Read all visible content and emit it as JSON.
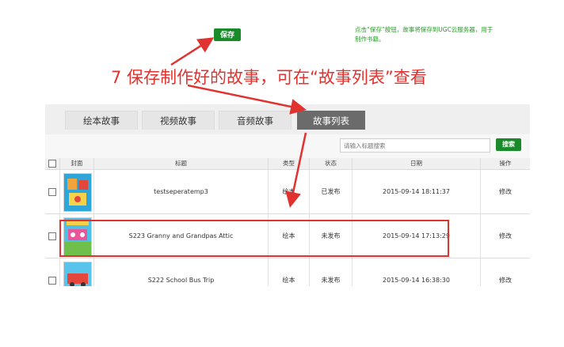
{
  "save_button": "保存",
  "tip": "点击“保存”按钮，故事将保存到UGC云服务器，用于制作书籍。",
  "step_annotation": "7 保存制作好的故事，可在“故事列表”查看",
  "tabs": [
    {
      "label": "绘本故事",
      "active": false
    },
    {
      "label": "视频故事",
      "active": false
    },
    {
      "label": "音频故事",
      "active": false
    },
    {
      "label": "故事列表",
      "active": true
    }
  ],
  "search": {
    "placeholder": "请输入标题搜索",
    "button": "搜索"
  },
  "table": {
    "headers": [
      "封面",
      "标题",
      "类型",
      "状态",
      "日期",
      "操作"
    ],
    "rows": [
      {
        "title": "testseperatemp3",
        "type": "绘本",
        "status": "已发布",
        "date": "2015-09-14 18:11:37",
        "action": "修改"
      },
      {
        "title": "S223 Granny and Grandpas Attic",
        "type": "绘本",
        "status": "未发布",
        "date": "2015-09-14 17:13:29",
        "action": "修改"
      },
      {
        "title": "S222 School Bus Trip",
        "type": "绘本",
        "status": "未发布",
        "date": "2015-09-14 16:38:30",
        "action": "修改"
      }
    ]
  },
  "colors": {
    "accent_green": "#1a8a2a",
    "annotation_red": "#e0322e",
    "active_tab": "#6b6b6b"
  }
}
